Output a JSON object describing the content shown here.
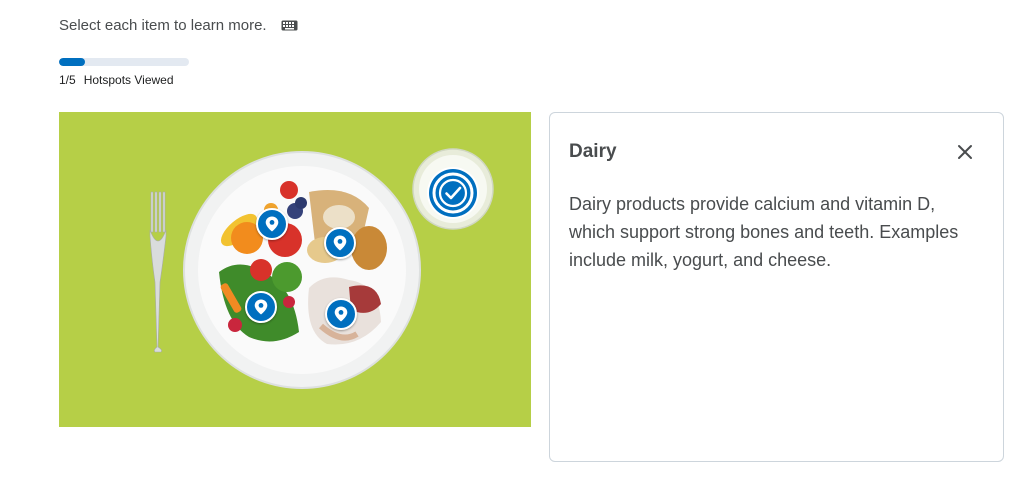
{
  "instructions": {
    "text": "Select each item to learn more.",
    "icon": "keyboard-icon"
  },
  "progress": {
    "viewed": 1,
    "total": 5,
    "fraction": 0.2,
    "count_text": "1/5",
    "label": "Hotspots Viewed",
    "color": "#006fbf"
  },
  "image": {
    "background_color": "#b6cf47",
    "hotspots": [
      {
        "name": "hotspot-fruits",
        "state": "unvisited"
      },
      {
        "name": "hotspot-grains",
        "state": "unvisited"
      },
      {
        "name": "hotspot-vegetables",
        "state": "unvisited"
      },
      {
        "name": "hotspot-protein",
        "state": "unvisited"
      },
      {
        "name": "hotspot-dairy",
        "state": "active"
      }
    ]
  },
  "panel": {
    "title": "Dairy",
    "body": "Dairy products provide calcium and vitamin D, which support strong bones and teeth. Examples include milk, yogurt, and cheese.",
    "close_icon": "close-icon"
  }
}
